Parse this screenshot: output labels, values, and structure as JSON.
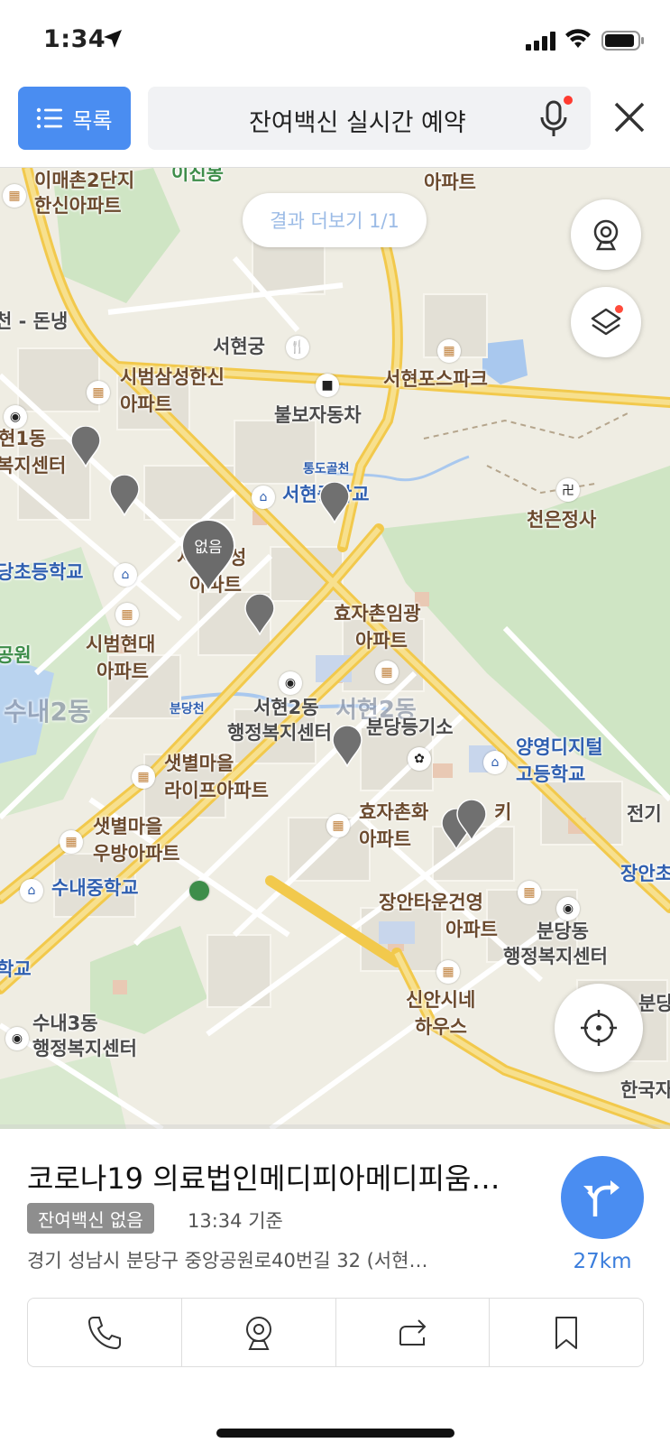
{
  "status_bar": {
    "time": "1:34"
  },
  "header": {
    "list_button": "목록",
    "search_query": "잔여백신 실시간 예약"
  },
  "map": {
    "more_results": "결과 더보기 1/1",
    "selected_pin_label": "없음",
    "labels": {
      "imaechon_1": "이매촌2단지",
      "imaechon_2": "한신아파트",
      "ijinbong": "이진봉",
      "apt_top": "아파트",
      "donaeng": "천 - 돈냉",
      "seohyeongung": "서현궁",
      "seohyeon_fospark": "서현포스파크",
      "sibeom_samsung_1": "시범삼성한신",
      "sibeom_samsung_2": "아파트",
      "bulbo": "불보자동차",
      "hyeon1_1": "현1동",
      "hyeon1_2": "복지센터",
      "tongdo": "통도골천",
      "seohyeon_school": "서현중학교",
      "cheoneun": "천은정사",
      "sibeom_woosung_1": "시범우성",
      "sibeom_woosung_2": "아파트",
      "dangcho": "당초등학교",
      "hyojachon_1": "효자촌임광",
      "hyojachon_2": "아파트",
      "sibeom_hyundai_1": "시범현대",
      "sibeom_hyundai_2": "아파트",
      "park": "공원",
      "sunae2": "수내2동",
      "bundangcheon": "분당천",
      "seohyeon2_1": "서현2동",
      "seohyeon2_2": "행정복지센터",
      "seohyeon2_faint": "서현2동",
      "bundang_power": "분당등기소",
      "yangyoung_1": "양영디지털",
      "yangyoung_2": "고등학교",
      "saetbyeol_life_1": "샛별마을",
      "saetbyeol_life_2": "라이프아파트",
      "hyojachon_hwa_1": "효자촌화",
      "hyojachon_hwa_2": "아파트",
      "ki": "키",
      "jeongi": "전기",
      "saetbyeol_woobang_1": "샛별마을",
      "saetbyeol_woobang_2": "우방아파트",
      "sunae_school": "수내중학교",
      "jangan_1": "장안타운건영",
      "jangan_2": "아파트",
      "jangan_right": "장안초",
      "bundangdong_1": "분당동",
      "bundangdong_2": "행정복지센터",
      "school_left": "학교",
      "sinan_1": "신안시네",
      "sinan_2": "하우스",
      "sunae3_1": "수내3동",
      "sunae3_2": "행정복지센터",
      "bundang_right": "분당",
      "hanguk": "한국자"
    }
  },
  "place": {
    "name": "코로나19 의료법인메디피아메디피움…",
    "badge": "잔여백신 없음",
    "time_basis": "13:34 기준",
    "address": "경기 성남시 분당구 중앙공원로40번길 32 (서현…",
    "distance": "27km"
  },
  "colors": {
    "accent": "#4a8df1",
    "map_bg": "#efede3",
    "road_major": "#f7d86a",
    "park": "#cfe5c4",
    "water": "#a9c8ee",
    "badge": "#8e8e8e"
  }
}
